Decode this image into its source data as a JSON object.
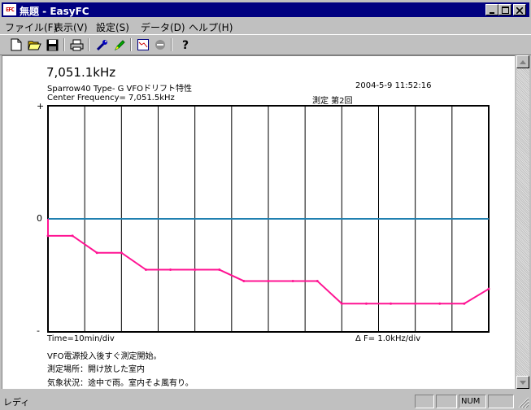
{
  "window": {
    "app_icon_text": "EFC",
    "title": "無題 - EasyFC"
  },
  "menu": [
    {
      "label": "ファイル(F)"
    },
    {
      "label": "表示(V)"
    },
    {
      "label": "設定(S)"
    },
    {
      "label": "データ(D)"
    },
    {
      "label": "ヘルプ(H)"
    }
  ],
  "toolbar": {
    "icons": [
      "new-file-icon",
      "open-folder-icon",
      "save-disk-icon",
      "print-icon",
      "wrench-icon",
      "pen-icon",
      "chart-icon",
      "stop-icon",
      "help-icon"
    ]
  },
  "doc": {
    "frequency_big": "7,051.1kHz",
    "model_line": "Sparrow40  Type- G  VFOドリフト特性",
    "datetime": "2004-5-9 11:52:16",
    "center_freq": "Center Frequency=   7,051.5kHz",
    "measurement": "測定  第2回",
    "yaxis_plus": "+",
    "yaxis_zero": "0",
    "yaxis_minus": "-",
    "time_div": "Time=10min/div",
    "freq_div": "Δ F=     1.0kHz/div",
    "note1": "VFO電源投入後すぐ測定開始。",
    "note2": "測定場所：開け放した室内",
    "note3": "気象状況：途中で雨。室内そよ風有り。"
  },
  "status": {
    "text": "レディ",
    "num": "NUM"
  },
  "colors": {
    "titlebar": "#000080",
    "baseline": "#2080b0",
    "trace": "#ff1493",
    "grid": "#000000"
  },
  "chart_data": {
    "type": "line",
    "series": [
      {
        "values": [
          -0.15,
          -0.15,
          -0.3,
          -0.3,
          -0.45,
          -0.45,
          -0.45,
          -0.45,
          -0.55,
          -0.55,
          -0.55,
          -0.55,
          -0.75,
          -0.75,
          -0.75,
          -0.75,
          -0.75,
          -0.75,
          -0.62
        ]
      }
    ],
    "ylim": [
      -1,
      1
    ],
    "xlim": [
      0,
      12
    ],
    "grid": true,
    "y_ticks": [
      "+",
      "0",
      "-"
    ]
  }
}
